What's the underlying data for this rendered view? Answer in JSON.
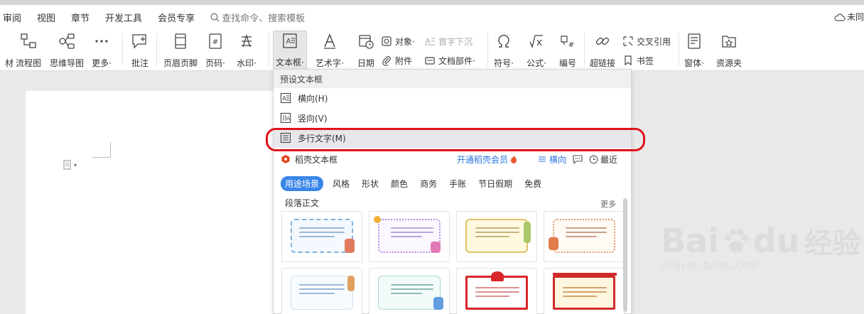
{
  "menubar": {
    "items": [
      "审阅",
      "视图",
      "章节",
      "开发工具",
      "会员专享"
    ],
    "search_placeholder": "查找命令、搜索模板",
    "cloud_label": "未同"
  },
  "ribbon": {
    "buttons": [
      {
        "label": "材",
        "icon": "partial-icon"
      },
      {
        "label": "流程图",
        "icon": "flowchart-icon"
      },
      {
        "label": "思维导图",
        "icon": "mindmap-icon"
      },
      {
        "label": "更多·",
        "icon": "more-dots-icon"
      },
      {
        "label": "批注",
        "icon": "comment-icon"
      },
      {
        "label": "页眉页脚",
        "icon": "header-footer-icon"
      },
      {
        "label": "页码·",
        "icon": "page-number-icon"
      },
      {
        "label": "水印·",
        "icon": "watermark-icon"
      },
      {
        "label": "文本框·",
        "icon": "textbox-icon"
      },
      {
        "label": "艺术字·",
        "icon": "wordart-icon"
      },
      {
        "label": "日期",
        "icon": "date-icon"
      },
      {
        "label": "符号·",
        "icon": "symbol-icon"
      },
      {
        "label": "公式·",
        "icon": "formula-icon"
      },
      {
        "label": "编号",
        "icon": "numbering-icon"
      },
      {
        "label": "超链接",
        "icon": "hyperlink-icon"
      },
      {
        "label": "窗体·",
        "icon": "form-icon"
      },
      {
        "label": "资源夹",
        "icon": "resource-folder-icon"
      }
    ],
    "small": {
      "object": "对象·",
      "attachment": "附件",
      "drop_cap": "首字下沉",
      "doc_parts": "文档部件·",
      "cross_ref": "交叉引用",
      "bookmark": "书签"
    }
  },
  "dropdown": {
    "header": "预设文本框",
    "items": [
      {
        "label": "横向(H)",
        "icon": "horizontal-textbox-icon"
      },
      {
        "label": "竖向(V)",
        "icon": "vertical-textbox-icon"
      },
      {
        "label": "多行文字(M)",
        "icon": "multiline-text-icon"
      }
    ],
    "daoke": {
      "title": "稻壳文本框",
      "open_member": "开通稻壳会员",
      "horizontal": "横向",
      "recent": "最近"
    },
    "tabs": [
      "用途场景",
      "风格",
      "形状",
      "颜色",
      "商务",
      "手账",
      "节日假期",
      "免费"
    ],
    "section_title": "段落正文",
    "more": "更多",
    "colors": {
      "accent": "#3a86e8",
      "highlight_oval": "#e0131a",
      "member_link": "#2a74e0"
    }
  },
  "watermark": {
    "brand": "Bai",
    "brand2": "du",
    "cn": "经验",
    "url": "jingyan.baidu.com"
  }
}
